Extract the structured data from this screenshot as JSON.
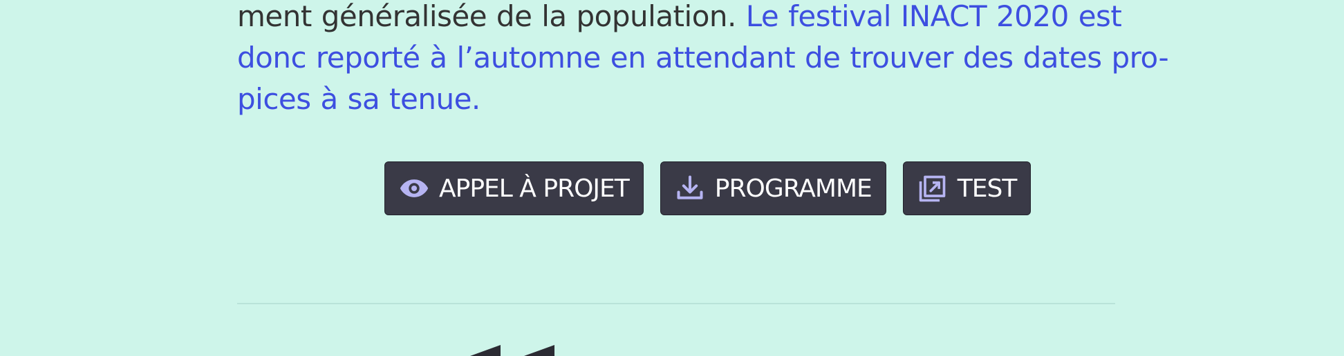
{
  "paragraph": {
    "line1_dark": "ment généralisée de la population.",
    "line1_link": "Le festival INACT 2020 est",
    "line2_link": "donc reporté à l’automne en attendant de trouver des dates pro-",
    "line3_link": "pices à sa tenue."
  },
  "buttons": [
    {
      "label": "APPEL À PROJET",
      "icon": "eye-icon"
    },
    {
      "label": "PROGRAMME",
      "icon": "download-icon"
    },
    {
      "label": "TEST",
      "icon": "external-link-icon"
    }
  ],
  "colors": {
    "background": "#cef5ea",
    "text": "#333333",
    "link": "#3d4fe0",
    "button_bg": "#3a3a47",
    "button_text": "#ffffff",
    "icon": "#b6b4f2",
    "divider": "#b9e3d9"
  }
}
